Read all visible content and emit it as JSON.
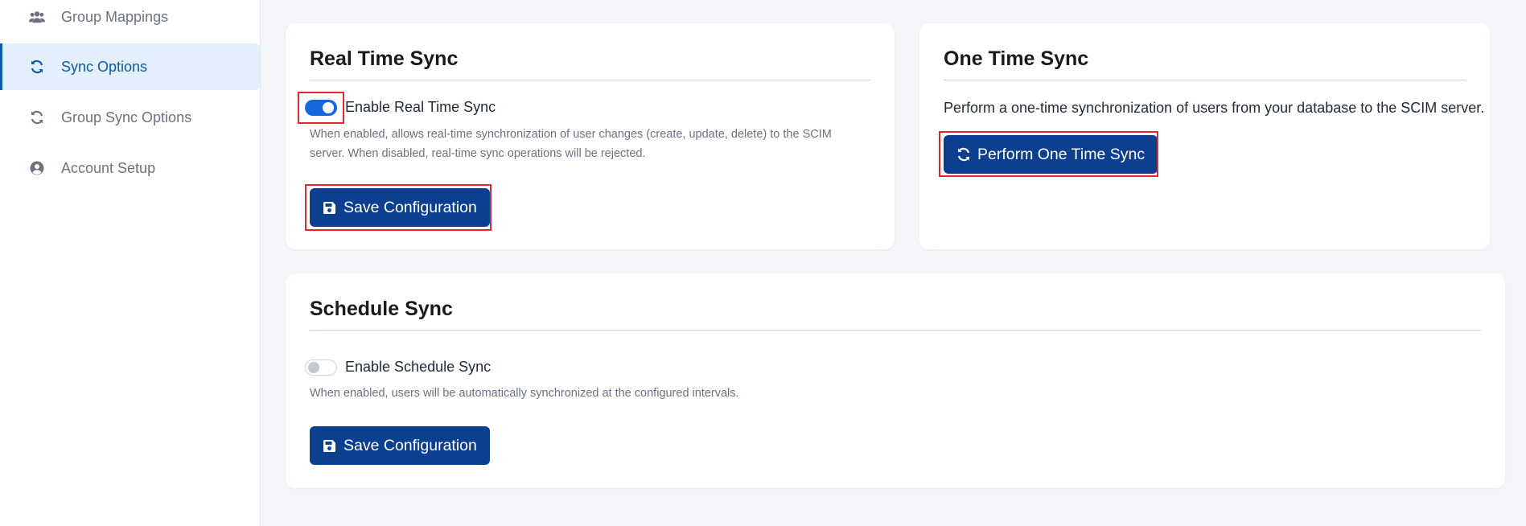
{
  "sidebar": {
    "items": [
      {
        "label": "Group Mappings",
        "icon": "users-icon"
      },
      {
        "label": "Sync Options",
        "icon": "sync-icon",
        "active": true
      },
      {
        "label": "Group Sync Options",
        "icon": "sync-icon"
      },
      {
        "label": "Account Setup",
        "icon": "user-circle-icon"
      }
    ]
  },
  "real_time_sync": {
    "title": "Real Time Sync",
    "toggle_label": "Enable Real Time Sync",
    "toggle_on": true,
    "help_line1": "When enabled, allows real-time synchronization of user changes (create, update, delete) to the SCIM",
    "help_line2": "server. When disabled, real-time sync operations will be rejected.",
    "save_label": "Save Configuration"
  },
  "one_time_sync": {
    "title": "One Time Sync",
    "description": "Perform a one-time synchronization of users from your database to the SCIM server.",
    "button_label": "Perform One Time Sync"
  },
  "schedule_sync": {
    "title": "Schedule Sync",
    "toggle_label": "Enable Schedule Sync",
    "toggle_on": false,
    "help": "When enabled, users will be automatically synchronized at the configured intervals.",
    "save_label": "Save Configuration"
  },
  "colors": {
    "primary_button": "#0d3f91",
    "toggle_on": "#1668dc",
    "active_nav": "#0d5aa7",
    "highlight": "#e0282e"
  }
}
